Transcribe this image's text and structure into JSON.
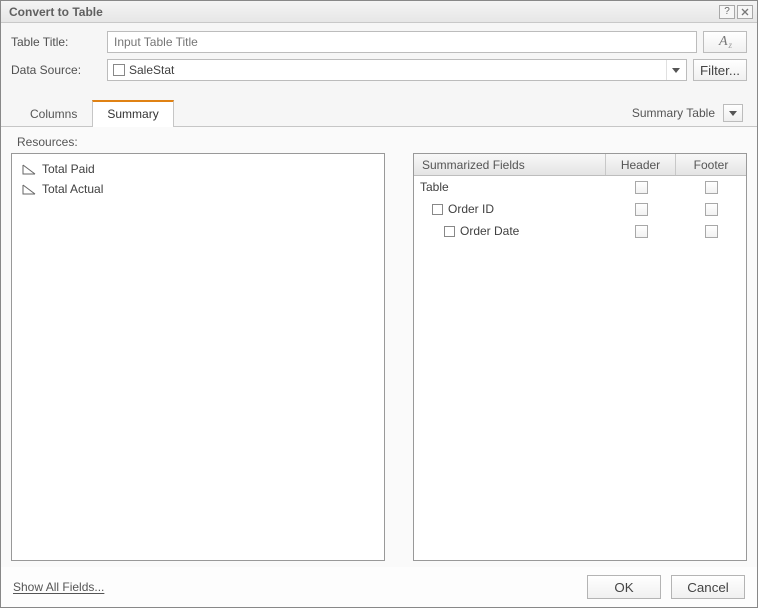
{
  "window": {
    "title": "Convert to Table"
  },
  "form": {
    "tableTitleLabel": "Table Title:",
    "tableTitlePlaceholder": "Input Table Title",
    "dataSourceLabel": "Data Source:",
    "dataSourceValue": "SaleStat",
    "filterLabel": "Filter...",
    "fontButtonGlyph": "A"
  },
  "tabs": {
    "columns": "Columns",
    "summary": "Summary",
    "summaryTableLabel": "Summary Table"
  },
  "resources": {
    "label": "Resources:",
    "items": [
      "Total Paid",
      "Total Actual"
    ]
  },
  "grid": {
    "headers": {
      "fields": "Summarized Fields",
      "header": "Header",
      "footer": "Footer"
    },
    "rows": [
      {
        "label": "Table",
        "indent": 0,
        "icon": false
      },
      {
        "label": "Order ID",
        "indent": 1,
        "icon": true
      },
      {
        "label": "Order Date",
        "indent": 2,
        "icon": true
      }
    ]
  },
  "footer": {
    "showAll": "Show All Fields...",
    "ok": "OK",
    "cancel": "Cancel"
  }
}
